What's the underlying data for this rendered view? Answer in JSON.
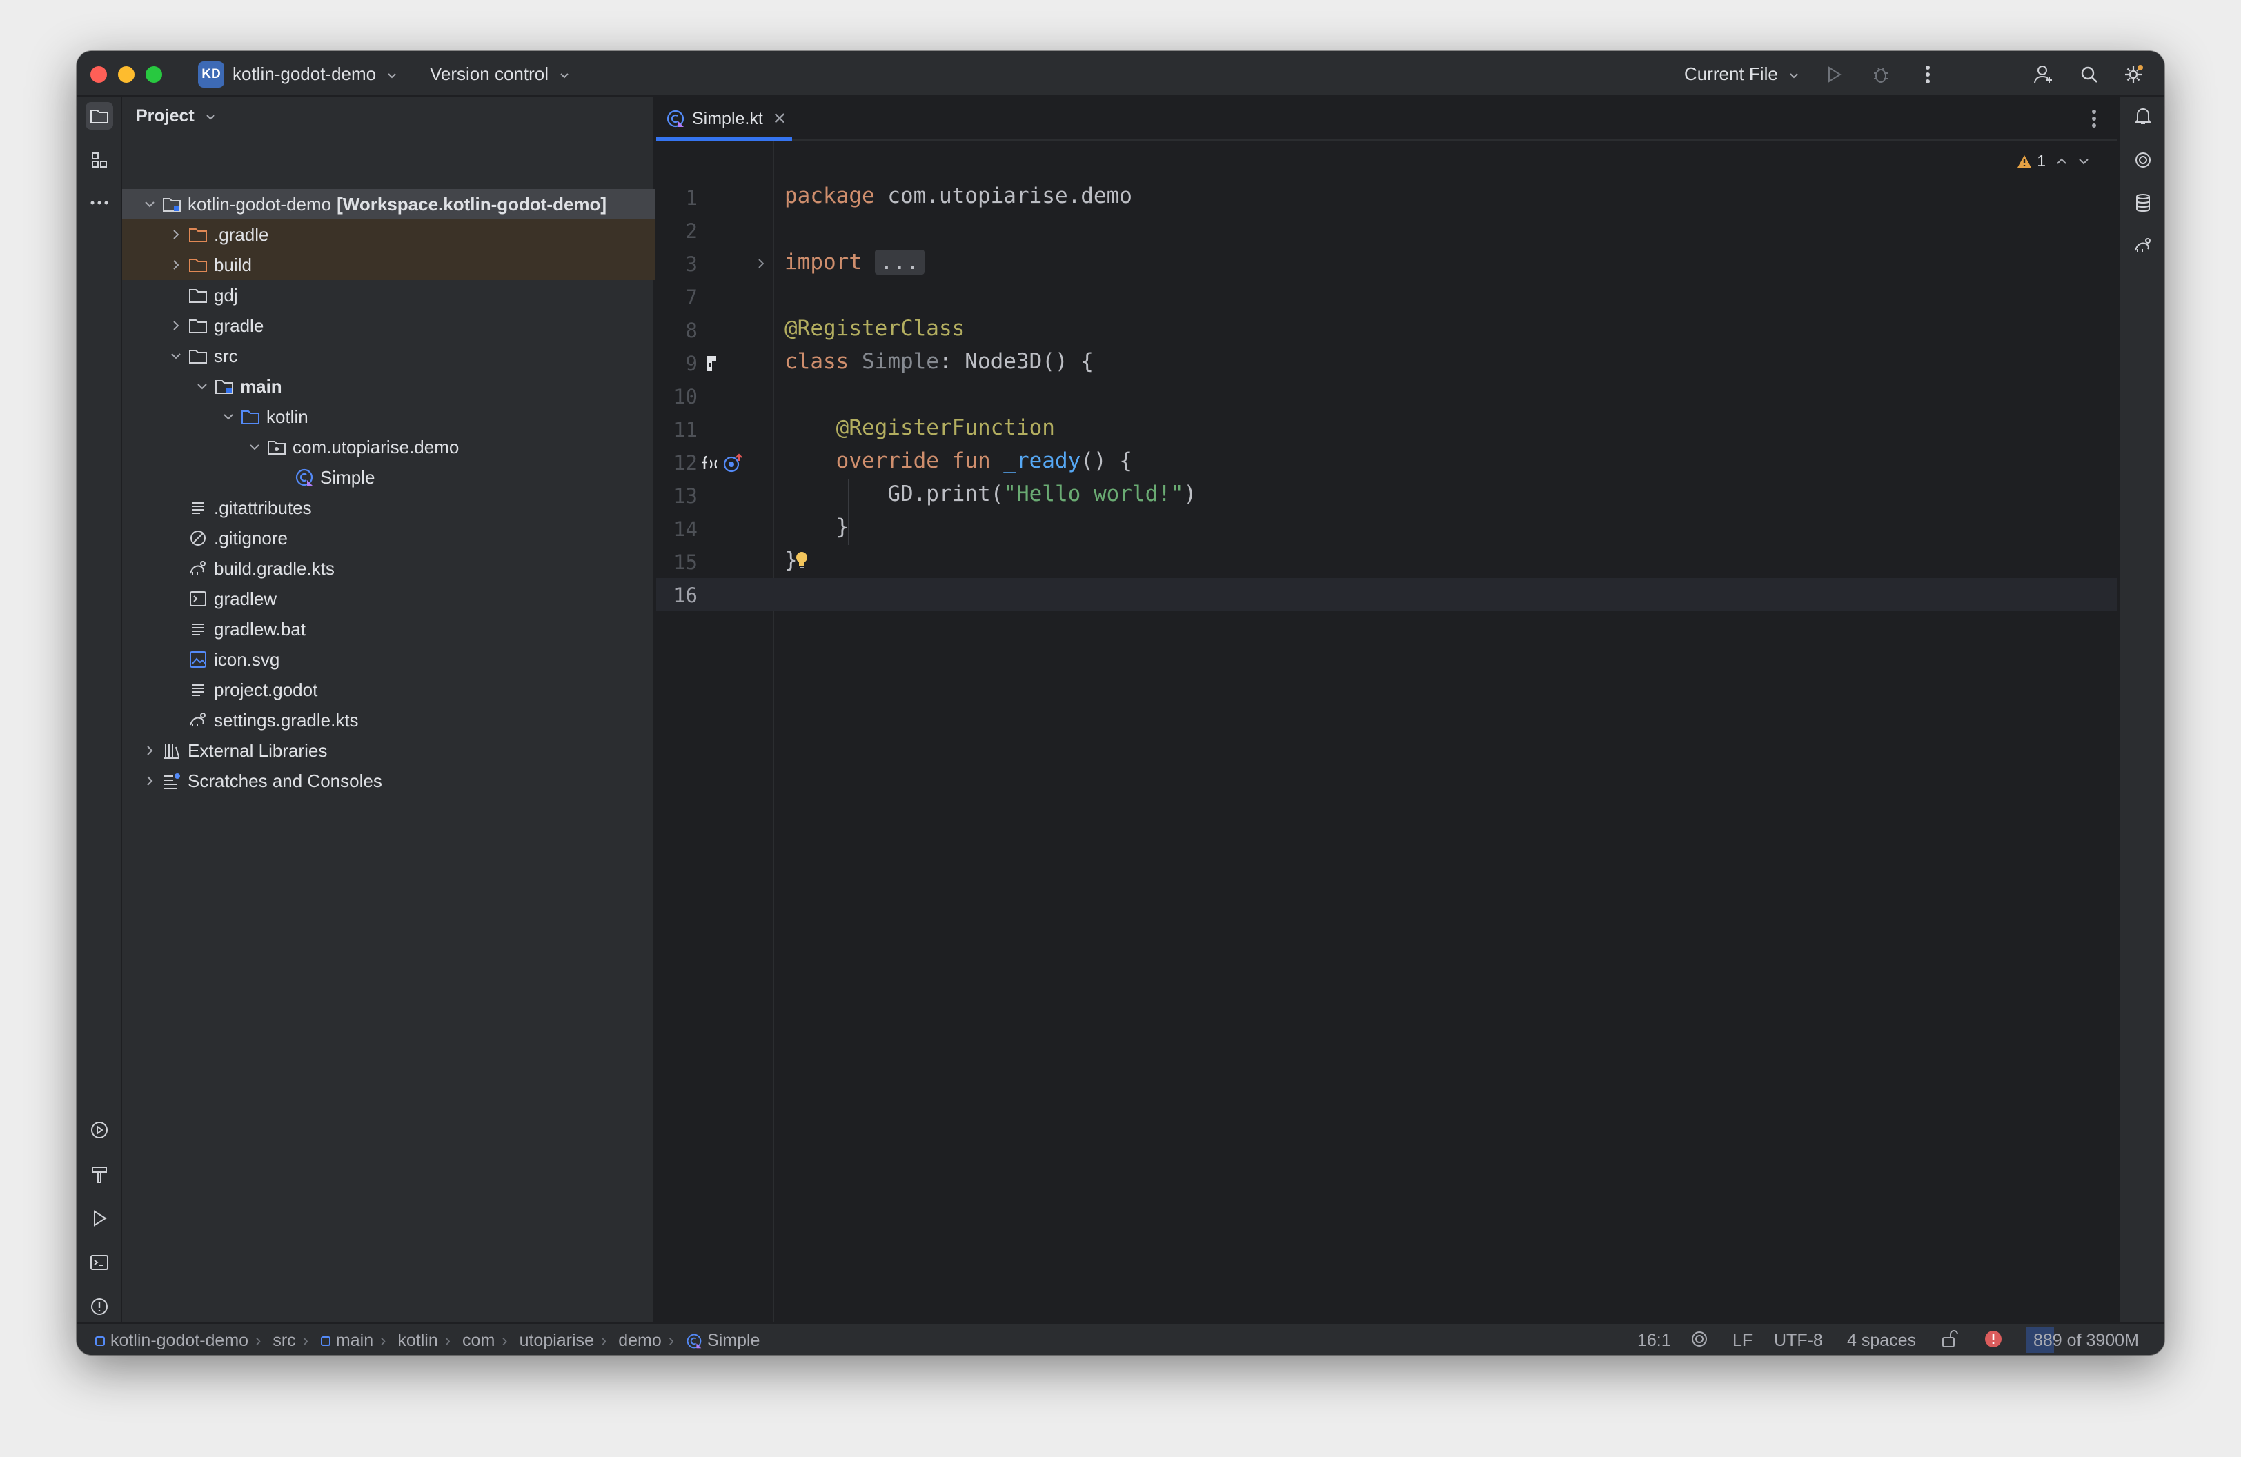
{
  "titlebar": {
    "project_badge": "KD",
    "project_name": "kotlin-godot-demo",
    "version_control": "Version control",
    "run_config": "Current File"
  },
  "project_panel": {
    "title": "Project",
    "root_name": "kotlin-godot-demo",
    "root_module": "[Workspace.kotlin-godot-demo]",
    "items": [
      {
        "label": ".gradle",
        "icon": "folder-icon"
      },
      {
        "label": "build",
        "icon": "folder-icon"
      },
      {
        "label": "gdj",
        "icon": "folder-icon"
      },
      {
        "label": "gradle",
        "icon": "folder-icon"
      },
      {
        "label": "src",
        "icon": "folder-icon"
      },
      {
        "label": "main",
        "icon": "source-folder-icon"
      },
      {
        "label": "kotlin",
        "icon": "source-folder-icon"
      },
      {
        "label": "com.utopiarise.demo",
        "icon": "package-icon"
      },
      {
        "label": "Simple",
        "icon": "kotlin-class-icon"
      },
      {
        "label": ".gitattributes",
        "icon": "text-file-icon"
      },
      {
        "label": ".gitignore",
        "icon": "ignore-file-icon"
      },
      {
        "label": "build.gradle.kts",
        "icon": "gradle-file-icon"
      },
      {
        "label": "gradlew",
        "icon": "shell-file-icon"
      },
      {
        "label": "gradlew.bat",
        "icon": "text-file-icon"
      },
      {
        "label": "icon.svg",
        "icon": "image-file-icon"
      },
      {
        "label": "project.godot",
        "icon": "text-file-icon"
      },
      {
        "label": "settings.gradle.kts",
        "icon": "gradle-file-icon"
      },
      {
        "label": "External Libraries",
        "icon": "library-icon"
      },
      {
        "label": "Scratches and Consoles",
        "icon": "scratches-icon"
      }
    ]
  },
  "editor": {
    "tab_label": "Simple.kt",
    "warning_count": "1",
    "line_numbers": [
      "1",
      "2",
      "3",
      "7",
      "8",
      "9",
      "10",
      "11",
      "12",
      "13",
      "14",
      "15",
      "16"
    ],
    "code": {
      "l1_kw": "package",
      "l1_rest": " com.utopiarise.demo",
      "l3_kw": "import",
      "l3_fold": "...",
      "l8_ann": "@RegisterClass",
      "l9_kw": "class",
      "l9_name": " Simple",
      "l9_rest": ": Node3D() {",
      "l11_ann": "@RegisterFunction",
      "l12_kw1": "override",
      "l12_kw2": " fun",
      "l12_fn": " _ready",
      "l12_rest": "() {",
      "l13_pre": "GD.print(",
      "l13_str": "\"Hello world!\"",
      "l13_post": ")",
      "l14": "}",
      "l15": "}"
    }
  },
  "statusbar": {
    "breadcrumbs": [
      "kotlin-godot-demo",
      "src",
      "main",
      "kotlin",
      "com",
      "utopiarise",
      "demo",
      "Simple"
    ],
    "position": "16:1",
    "line_sep": "LF",
    "encoding": "UTF-8",
    "indent": "4 spaces",
    "memory": "889 of 3900M"
  },
  "colors": {
    "accent": "#3574f0",
    "keyword": "#cf8e6d",
    "annotation": "#b3ae60",
    "string": "#6aab73",
    "function": "#56a8f5",
    "excluded_folder": "#3b3227"
  }
}
